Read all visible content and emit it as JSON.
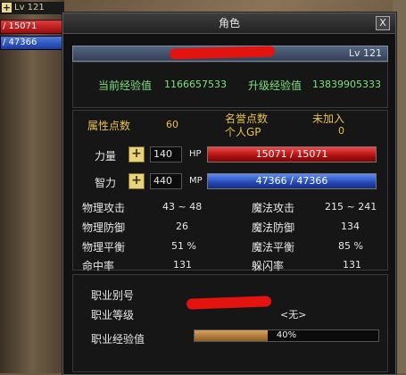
{
  "hud": {
    "level": "Lv 121",
    "hp_text": "/ 15071",
    "mp_text": "/ 47366",
    "plus_icon": "plus-icon"
  },
  "window": {
    "title": "角色",
    "close_label": "X",
    "level": "Lv 121"
  },
  "exp": {
    "current_label": "当前经验值",
    "current_value": "1166657533",
    "next_label": "升级经验值",
    "next_value": "13839905333"
  },
  "points": {
    "attr_label": "属性点数",
    "attr_value": "60",
    "fame_label": "名誉点数",
    "fame_value": "未加入",
    "personal_gp_label": "个人GP",
    "personal_gp_value": "0"
  },
  "stats": {
    "str_label": "力量",
    "str_value": "140",
    "int_label": "智力",
    "int_value": "440",
    "hp_label": "HP",
    "hp_bar_text": "15071 / 15071",
    "hp_fraction": 1.0,
    "mp_label": "MP",
    "mp_bar_text": "47366 / 47366",
    "mp_fraction": 1.0
  },
  "combat": {
    "phys_atk_label": "物理攻击",
    "phys_atk_value": "43 ~ 48",
    "mag_atk_label": "魔法攻击",
    "mag_atk_value": "215 ~ 241",
    "phys_def_label": "物理防御",
    "phys_def_value": "26",
    "mag_def_label": "魔法防御",
    "mag_def_value": "134",
    "phys_bal_label": "物理平衡",
    "phys_bal_value": "51 %",
    "mag_bal_label": "魔法平衡",
    "mag_bal_value": "85 %",
    "hit_label": "命中率",
    "hit_value": "131",
    "dodge_label": "躲闪率",
    "dodge_value": "131"
  },
  "job": {
    "alias_label": "职业别号",
    "level_label": "职业等级",
    "level_value": "<无>",
    "exp_label": "职业经验值",
    "exp_pct_text": "40%",
    "exp_fraction": 0.4
  },
  "colors": {
    "green_text": "#7ee07e",
    "gold_text": "#e9c14a",
    "hp_bar": "#d42a2a",
    "mp_bar": "#2f56c8",
    "redaction": "#e3130f"
  }
}
